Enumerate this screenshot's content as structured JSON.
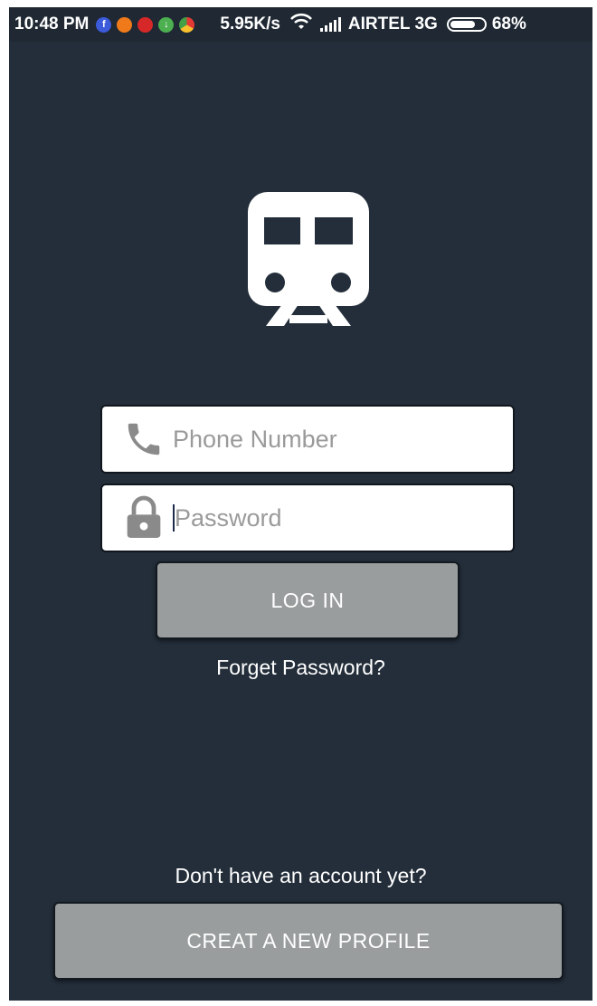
{
  "status_bar": {
    "time": "10:48 PM",
    "net_speed": "5.95K/s",
    "carrier": "AIRTEL 3G",
    "battery": "68%",
    "battery_level": 0.68,
    "notification_icons": [
      "facebook-icon",
      "app-icon-orange",
      "app-icon-red",
      "download-icon",
      "chrome-icon"
    ]
  },
  "logo": {
    "icon": "train-icon"
  },
  "login_form": {
    "phone_placeholder": "Phone Number",
    "phone_icon": "phone-icon",
    "password_placeholder": "Password",
    "password_icon": "lock-icon",
    "login_label": "LOG IN",
    "forgot_label": "Forget Password?"
  },
  "signup": {
    "prompt": "Don't have an account yet?",
    "create_label": "CREAT A NEW PROFILE"
  },
  "colors": {
    "background": "#232e3a",
    "button": "#9a9d9d",
    "field": "#ffffff"
  }
}
